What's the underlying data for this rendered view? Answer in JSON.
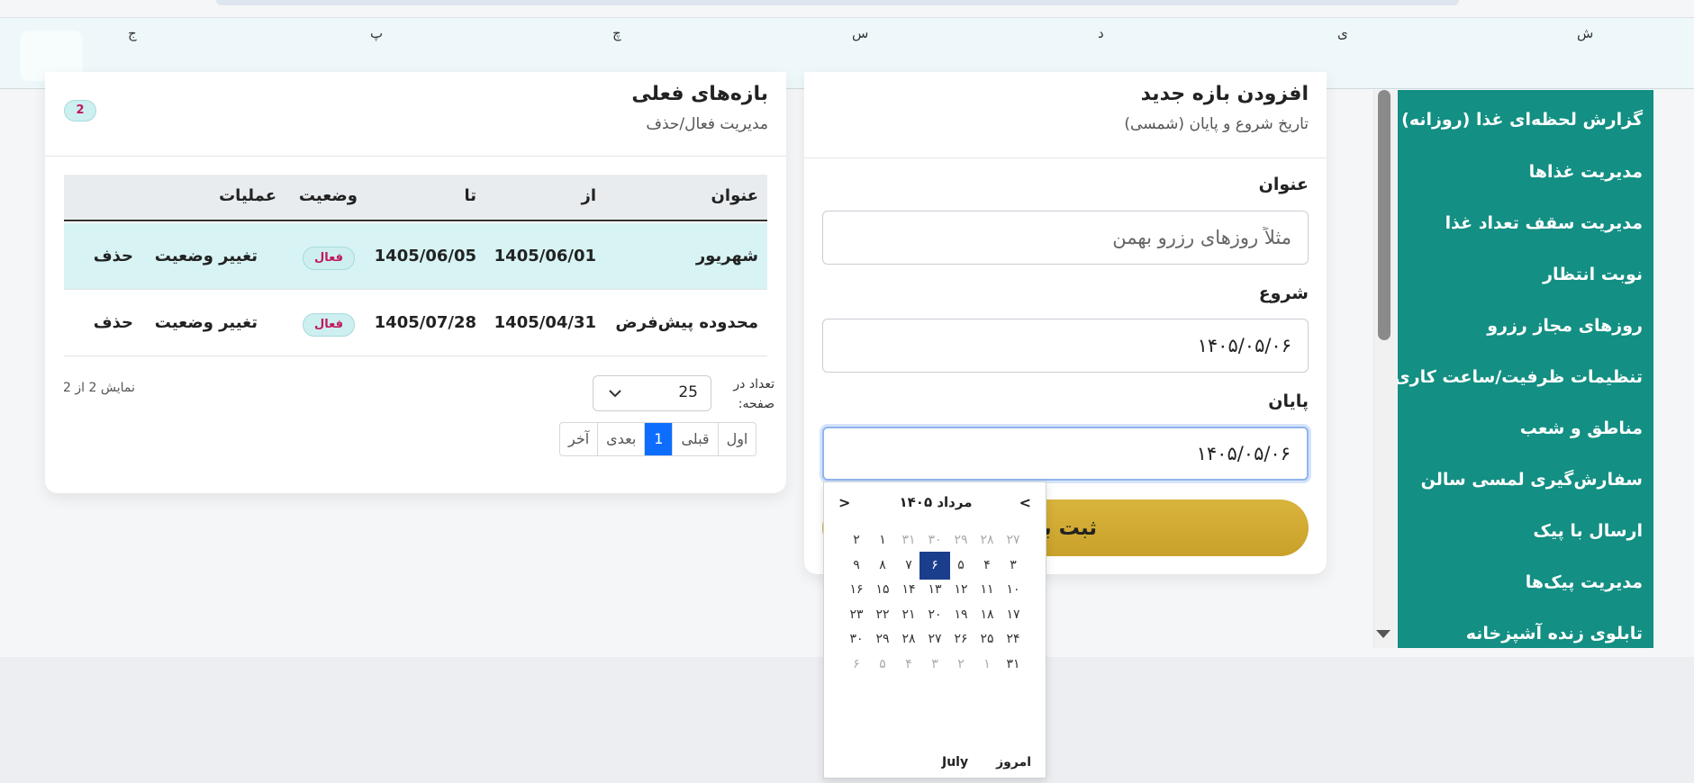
{
  "weekdays": [
    "ش",
    "ی",
    "د",
    "س",
    "چ",
    "پ",
    "ج"
  ],
  "sidebar": {
    "items": [
      {
        "label": "گزارش لحظه‌ای غذا (روزانه)"
      },
      {
        "label": "مدیریت غذاها"
      },
      {
        "label": "مدیریت سقف تعداد غذا"
      },
      {
        "label": "نوبت انتظار"
      },
      {
        "label": "روزهای مجاز رزرو"
      },
      {
        "label": "تنظیمات ظرفیت/ساعت کاری"
      },
      {
        "label": "مناطق و شعب"
      },
      {
        "label": "سفارش‌گیری لمسی سالن"
      },
      {
        "label": "ارسال با پیک"
      },
      {
        "label": "مدیریت پیک‌ها"
      },
      {
        "label": "تابلوی زنده آشپزخانه"
      }
    ]
  },
  "add_form": {
    "title": "افزودن بازه جدید",
    "subtitle": "تاریخ شروع و پایان (شمسی)",
    "title_label": "عنوان",
    "title_placeholder": "مثلاً روزهای رزرو بهمن",
    "start_label": "شروع",
    "start_value": "۱۴۰۵/۰۵/۰۶",
    "end_label": "پایان",
    "end_value": "۱۴۰۵/۰۵/۰۶",
    "submit_label": "ثبت با"
  },
  "ranges": {
    "title": "بازه‌های فعلی",
    "subtitle": "مدیریت فعال/حذف",
    "count": "2",
    "columns": {
      "title": "عنوان",
      "from": "از",
      "to": "تا",
      "status": "وضعیت",
      "actions": "عملیات"
    },
    "rows": [
      {
        "title": "شهریور",
        "from": "1405/06/01",
        "to": "1405/06/05",
        "status": "فعال",
        "toggle": "تغییر وضعیت",
        "delete": "حذف"
      },
      {
        "title": "محدوده پیش‌فرض",
        "from": "1405/04/31",
        "to": "1405/07/28",
        "status": "فعال",
        "toggle": "تغییر وضعیت",
        "delete": "حذف"
      }
    ],
    "showing": "نمایش 2 از 2",
    "per_page_label": "تعداد در صفحه:",
    "per_page_value": "25",
    "pager": {
      "first": "اول",
      "prev": "قبلی",
      "current": "1",
      "next": "بعدی",
      "last": "آخر"
    }
  },
  "datepicker": {
    "month_title": "مرداد ۱۴۰۵",
    "prev": "<",
    "next": ">",
    "today_label": "امروز",
    "month_label": "July",
    "weeks": [
      [
        {
          "d": "۲۷",
          "m": true
        },
        {
          "d": "۲۸",
          "m": true
        },
        {
          "d": "۲۹",
          "m": true
        },
        {
          "d": "۳۰",
          "m": true
        },
        {
          "d": "۳۱",
          "m": true
        },
        {
          "d": "۱"
        },
        {
          "d": "۲"
        }
      ],
      [
        {
          "d": "۳"
        },
        {
          "d": "۴"
        },
        {
          "d": "۵"
        },
        {
          "d": "۶",
          "s": true
        },
        {
          "d": "۷"
        },
        {
          "d": "۸"
        },
        {
          "d": "۹"
        }
      ],
      [
        {
          "d": "۱۰"
        },
        {
          "d": "۱۱"
        },
        {
          "d": "۱۲"
        },
        {
          "d": "۱۳"
        },
        {
          "d": "۱۴"
        },
        {
          "d": "۱۵"
        },
        {
          "d": "۱۶"
        }
      ],
      [
        {
          "d": "۱۷"
        },
        {
          "d": "۱۸"
        },
        {
          "d": "۱۹"
        },
        {
          "d": "۲۰"
        },
        {
          "d": "۲۱"
        },
        {
          "d": "۲۲"
        },
        {
          "d": "۲۳"
        }
      ],
      [
        {
          "d": "۲۴"
        },
        {
          "d": "۲۵"
        },
        {
          "d": "۲۶"
        },
        {
          "d": "۲۷"
        },
        {
          "d": "۲۸"
        },
        {
          "d": "۲۹"
        },
        {
          "d": "۳۰"
        }
      ],
      [
        {
          "d": "۳۱"
        },
        {
          "d": "۱",
          "m": true
        },
        {
          "d": "۲",
          "m": true
        },
        {
          "d": "۳",
          "m": true
        },
        {
          "d": "۴",
          "m": true
        },
        {
          "d": "۵",
          "m": true
        },
        {
          "d": "۶",
          "m": true
        }
      ]
    ]
  }
}
